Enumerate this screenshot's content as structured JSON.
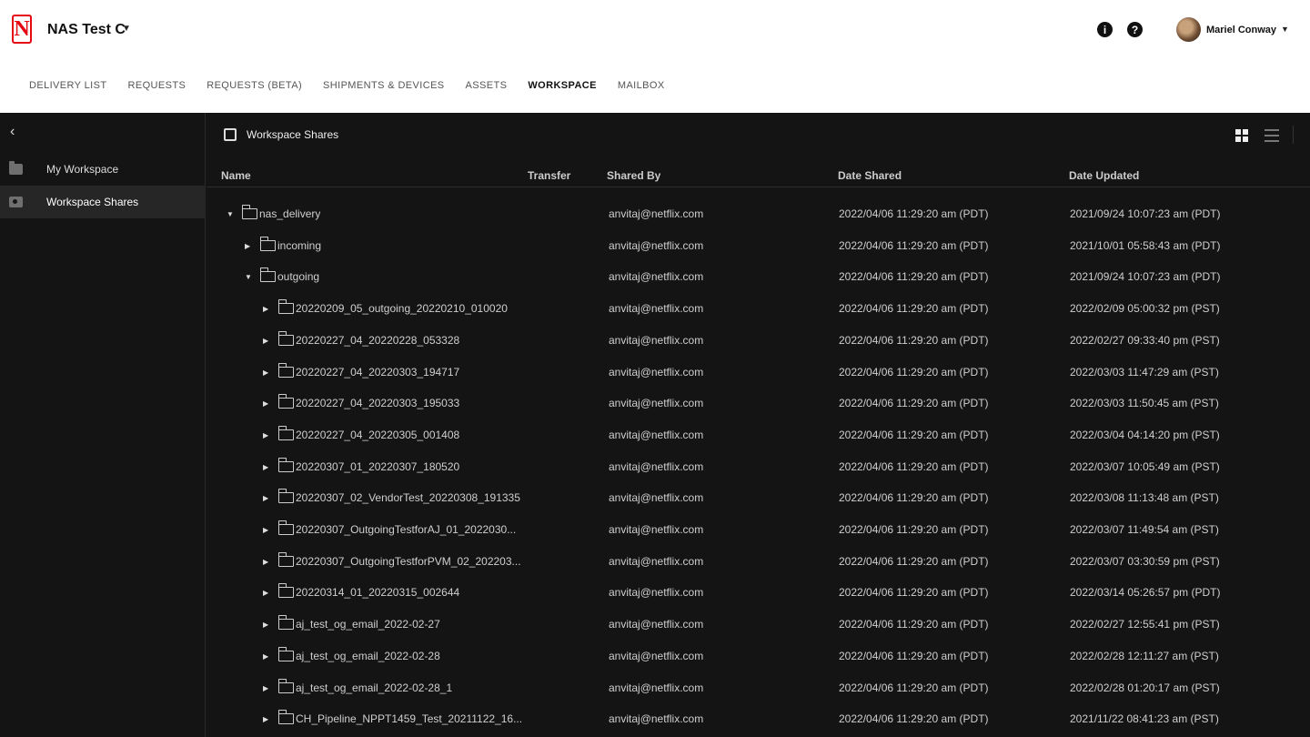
{
  "header": {
    "logo_letter": "N",
    "app_title": "NAS Test C",
    "user_name": "Mariel Conway",
    "info_icon": "info-icon",
    "help_icon": "help-icon"
  },
  "nav": {
    "items": [
      "DELIVERY LIST",
      "REQUESTS",
      "REQUESTS (BETA)",
      "SHIPMENTS & DEVICES",
      "ASSETS",
      "WORKSPACE",
      "MAILBOX"
    ],
    "active": "WORKSPACE"
  },
  "sidebar": {
    "items": [
      {
        "label": "My Workspace",
        "icon": "folder-icon"
      },
      {
        "label": "Workspace Shares",
        "icon": "shared-folder-icon",
        "active": true
      }
    ]
  },
  "main": {
    "title": "Workspace Shares",
    "columns": {
      "name": "Name",
      "transfer": "Transfer",
      "shared_by": "Shared By",
      "date_shared": "Date Shared",
      "date_updated": "Date Updated"
    },
    "rows": [
      {
        "level": 0,
        "expanded": true,
        "name": "nas_delivery",
        "shared_by": "anvitaj@netflix.com",
        "date_shared": "2022/04/06 11:29:20 am (PDT)",
        "date_updated": "2021/09/24 10:07:23 am (PDT)"
      },
      {
        "level": 1,
        "expanded": false,
        "name": "incoming",
        "shared_by": "anvitaj@netflix.com",
        "date_shared": "2022/04/06 11:29:20 am (PDT)",
        "date_updated": "2021/10/01 05:58:43 am (PDT)"
      },
      {
        "level": 1,
        "expanded": true,
        "name": "outgoing",
        "shared_by": "anvitaj@netflix.com",
        "date_shared": "2022/04/06 11:29:20 am (PDT)",
        "date_updated": "2021/09/24 10:07:23 am (PDT)"
      },
      {
        "level": 2,
        "expanded": false,
        "name": "20220209_05_outgoing_20220210_010020",
        "shared_by": "anvitaj@netflix.com",
        "date_shared": "2022/04/06 11:29:20 am (PDT)",
        "date_updated": "2022/02/09 05:00:32 pm (PST)"
      },
      {
        "level": 2,
        "expanded": false,
        "name": "20220227_04_20220228_053328",
        "shared_by": "anvitaj@netflix.com",
        "date_shared": "2022/04/06 11:29:20 am (PDT)",
        "date_updated": "2022/02/27 09:33:40 pm (PST)"
      },
      {
        "level": 2,
        "expanded": false,
        "name": "20220227_04_20220303_194717",
        "shared_by": "anvitaj@netflix.com",
        "date_shared": "2022/04/06 11:29:20 am (PDT)",
        "date_updated": "2022/03/03 11:47:29 am (PST)"
      },
      {
        "level": 2,
        "expanded": false,
        "name": "20220227_04_20220303_195033",
        "shared_by": "anvitaj@netflix.com",
        "date_shared": "2022/04/06 11:29:20 am (PDT)",
        "date_updated": "2022/03/03 11:50:45 am (PST)"
      },
      {
        "level": 2,
        "expanded": false,
        "name": "20220227_04_20220305_001408",
        "shared_by": "anvitaj@netflix.com",
        "date_shared": "2022/04/06 11:29:20 am (PDT)",
        "date_updated": "2022/03/04 04:14:20 pm (PST)"
      },
      {
        "level": 2,
        "expanded": false,
        "name": "20220307_01_20220307_180520",
        "shared_by": "anvitaj@netflix.com",
        "date_shared": "2022/04/06 11:29:20 am (PDT)",
        "date_updated": "2022/03/07 10:05:49 am (PST)"
      },
      {
        "level": 2,
        "expanded": false,
        "name": "20220307_02_VendorTest_20220308_191335",
        "shared_by": "anvitaj@netflix.com",
        "date_shared": "2022/04/06 11:29:20 am (PDT)",
        "date_updated": "2022/03/08 11:13:48 am (PST)"
      },
      {
        "level": 2,
        "expanded": false,
        "name": "20220307_OutgoingTestforAJ_01_2022030...",
        "shared_by": "anvitaj@netflix.com",
        "date_shared": "2022/04/06 11:29:20 am (PDT)",
        "date_updated": "2022/03/07 11:49:54 am (PST)"
      },
      {
        "level": 2,
        "expanded": false,
        "name": "20220307_OutgoingTestforPVM_02_202203...",
        "shared_by": "anvitaj@netflix.com",
        "date_shared": "2022/04/06 11:29:20 am (PDT)",
        "date_updated": "2022/03/07 03:30:59 pm (PST)"
      },
      {
        "level": 2,
        "expanded": false,
        "name": "20220314_01_20220315_002644",
        "shared_by": "anvitaj@netflix.com",
        "date_shared": "2022/04/06 11:29:20 am (PDT)",
        "date_updated": "2022/03/14 05:26:57 pm (PDT)"
      },
      {
        "level": 2,
        "expanded": false,
        "name": "aj_test_og_email_2022-02-27",
        "shared_by": "anvitaj@netflix.com",
        "date_shared": "2022/04/06 11:29:20 am (PDT)",
        "date_updated": "2022/02/27 12:55:41 pm (PST)"
      },
      {
        "level": 2,
        "expanded": false,
        "name": "aj_test_og_email_2022-02-28",
        "shared_by": "anvitaj@netflix.com",
        "date_shared": "2022/04/06 11:29:20 am (PDT)",
        "date_updated": "2022/02/28 12:11:27 am (PST)"
      },
      {
        "level": 2,
        "expanded": false,
        "name": "aj_test_og_email_2022-02-28_1",
        "shared_by": "anvitaj@netflix.com",
        "date_shared": "2022/04/06 11:29:20 am (PDT)",
        "date_updated": "2022/02/28 01:20:17 am (PST)"
      },
      {
        "level": 2,
        "expanded": false,
        "name": "CH_Pipeline_NPPT1459_Test_20211122_16...",
        "shared_by": "anvitaj@netflix.com",
        "date_shared": "2022/04/06 11:29:20 am (PDT)",
        "date_updated": "2021/11/22 08:41:23 am (PST)"
      }
    ]
  },
  "colors": {
    "brand": "#e50914",
    "background": "#141414",
    "header_bg": "#ffffff"
  }
}
